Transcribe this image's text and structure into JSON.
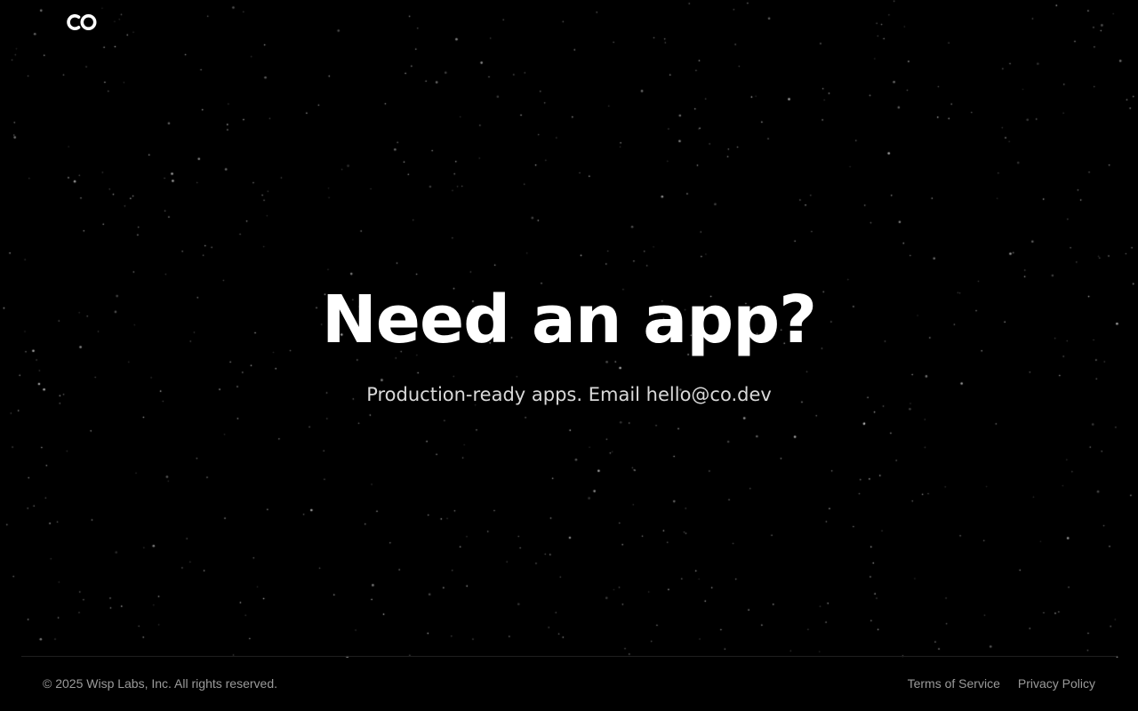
{
  "header": {
    "logo_icon": "co-logo-icon"
  },
  "hero": {
    "title": "Need an app?",
    "subtitle_prefix": "Production-ready apps. Email ",
    "email": "hello@co.dev"
  },
  "footer": {
    "copyright": "© 2025 Wisp Labs, Inc. All rights reserved.",
    "links": [
      {
        "label": "Terms of Service"
      },
      {
        "label": "Privacy Policy"
      }
    ]
  },
  "colors": {
    "background": "#000000",
    "title": "#ffffff",
    "subtitle": "#d9d9d9",
    "footer_text": "#9a9a9a",
    "divider": "#1f1f1f",
    "star": "#ffffff"
  }
}
